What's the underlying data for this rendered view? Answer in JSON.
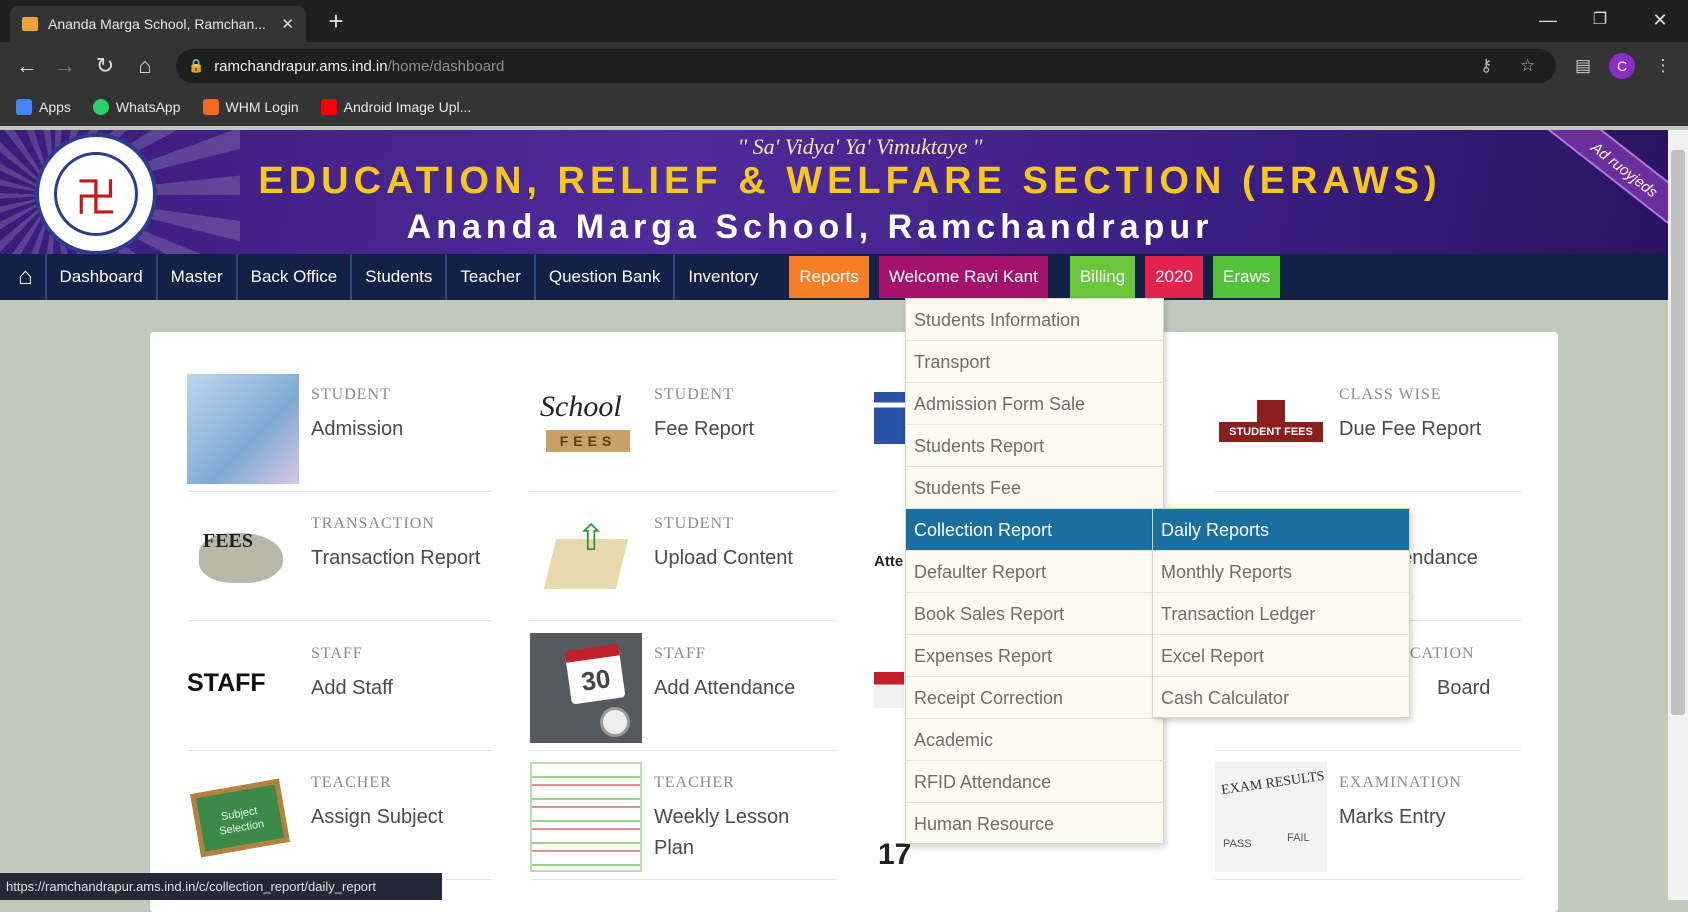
{
  "browser": {
    "tab_title": "Ananda Marga School, Ramchan...",
    "tab_close": "✕",
    "new_tab": "+",
    "url_host": "ramchandrapur.ams.ind.in",
    "url_path": "/home/dashboard",
    "profile_initial": "C",
    "bookmarks": [
      {
        "label": "Apps",
        "color": "#e34c3a"
      },
      {
        "label": "WhatsApp",
        "color": "#25d366"
      },
      {
        "label": "WHM Login",
        "color": "#f26722"
      },
      {
        "label": "Android Image Upl...",
        "color": "#ff0000"
      }
    ],
    "status_url": "https://ramchandrapur.ams.ind.in/c/collection_report/daily_report"
  },
  "banner": {
    "motto": "'' Sa' Vidya' Ya' Vimuktaye ''",
    "headline": "EDUCATION, RELIEF & WELFARE SECTION (ERAWS)",
    "school": "Ananda Marga School, Ramchandrapur",
    "ribbon": "Ad ruoyjeds"
  },
  "nav": {
    "items": [
      "Dashboard",
      "Master",
      "Back Office",
      "Students",
      "Teacher",
      "Question Bank",
      "Inventory"
    ],
    "reports": "Reports",
    "welcome": "Welcome Ravi Kant",
    "billing": "Billing",
    "year": "2020",
    "eraws": "Eraws",
    "colors": {
      "reports": "#f57f25",
      "welcome": "#a3136e",
      "billing": "#6ac63a",
      "year": "#e3234e",
      "eraws": "#54c13a"
    }
  },
  "tiles": [
    {
      "cat": "STUDENT",
      "name": "Admission"
    },
    {
      "cat": "STUDENT",
      "name": "Fee Report"
    },
    {
      "cat": "CLASS WISE",
      "name": "Due Fee Report"
    },
    {
      "cat": "TRANSACTION",
      "name": "Transaction Report"
    },
    {
      "cat": "STUDENT",
      "name": "Upload Content"
    },
    {
      "cat": "T",
      "name": "ttendance"
    },
    {
      "cat": "STAFF",
      "name": "Add Staff"
    },
    {
      "cat": "STAFF",
      "name": "Add Attendance"
    },
    {
      "cat": "NICATION",
      "name": "Board"
    },
    {
      "cat": "TEACHER",
      "name": "Assign Subject"
    },
    {
      "cat": "TEACHER",
      "name": "Weekly Lesson Plan"
    },
    {
      "cat": "EXAMINATION",
      "name": "Marks Entry"
    }
  ],
  "tile_images": {
    "school_fees": "School",
    "fees": "FEES",
    "staff": "STAFF",
    "student_fees": "STUDENT FEES",
    "calendar": "30",
    "subject": "Subject Selection",
    "exam": "EXAM RESULTS",
    "pass": "PASS",
    "fail": "FAIL",
    "partial_number": "17",
    "att_prefix": "Atte"
  },
  "reports_menu": [
    "Students Information",
    "Transport",
    "Admission Form Sale",
    "Students Report",
    "Students Fee",
    "Collection Report",
    "Defaulter Report",
    "Book Sales Report",
    "Expenses Report",
    "Receipt Correction",
    "Academic",
    "RFID Attendance",
    "Human Resource"
  ],
  "collection_submenu": [
    "Daily Reports",
    "Monthly Reports",
    "Transaction Ledger",
    "Excel Report",
    "Cash Calculator"
  ]
}
